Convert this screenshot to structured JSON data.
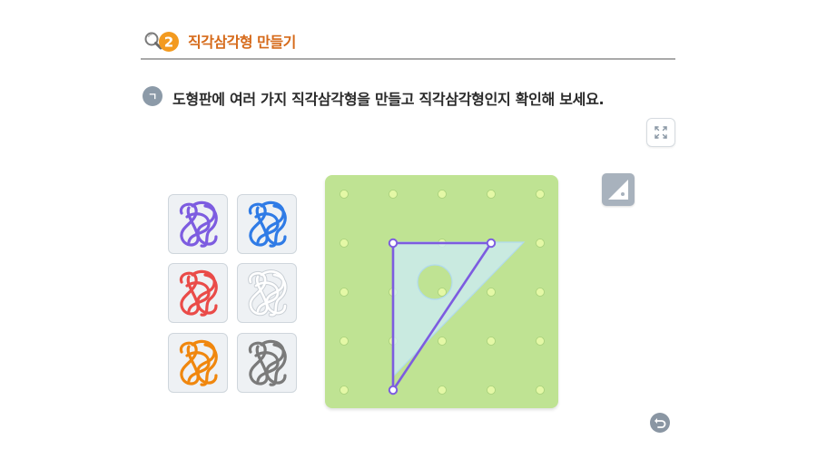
{
  "section": {
    "number": "2",
    "title": "직각삼각형 만들기",
    "icon": "magnifier-icon",
    "accent_color": "#f39a1f"
  },
  "question": {
    "marker": "ㄱ",
    "text": "도형판에 여러 가지 직각삼각형을 만들고 직각삼각형인지 확인해 보세요."
  },
  "controls": {
    "expand_icon": "expand-icon",
    "set_square_icon": "set-square-icon",
    "undo_icon": "undo-icon"
  },
  "rubber_bands": [
    {
      "color_name": "purple",
      "color": "#7d5ce0"
    },
    {
      "color_name": "blue",
      "color": "#2f7be6"
    },
    {
      "color_name": "red",
      "color": "#ea4b48"
    },
    {
      "color_name": "white",
      "color": "#ffffff"
    },
    {
      "color_name": "orange",
      "color": "#f0870e"
    },
    {
      "color_name": "gray",
      "color": "#7a7a7a"
    }
  ],
  "geoboard": {
    "rows": 5,
    "cols": 5,
    "board_color": "#bfe393",
    "peg_color": "#e4f8a6",
    "band_color": "#7d5ce0",
    "triangle_pegs": [
      [
        1,
        1
      ],
      [
        3,
        1
      ],
      [
        1,
        4
      ]
    ]
  }
}
